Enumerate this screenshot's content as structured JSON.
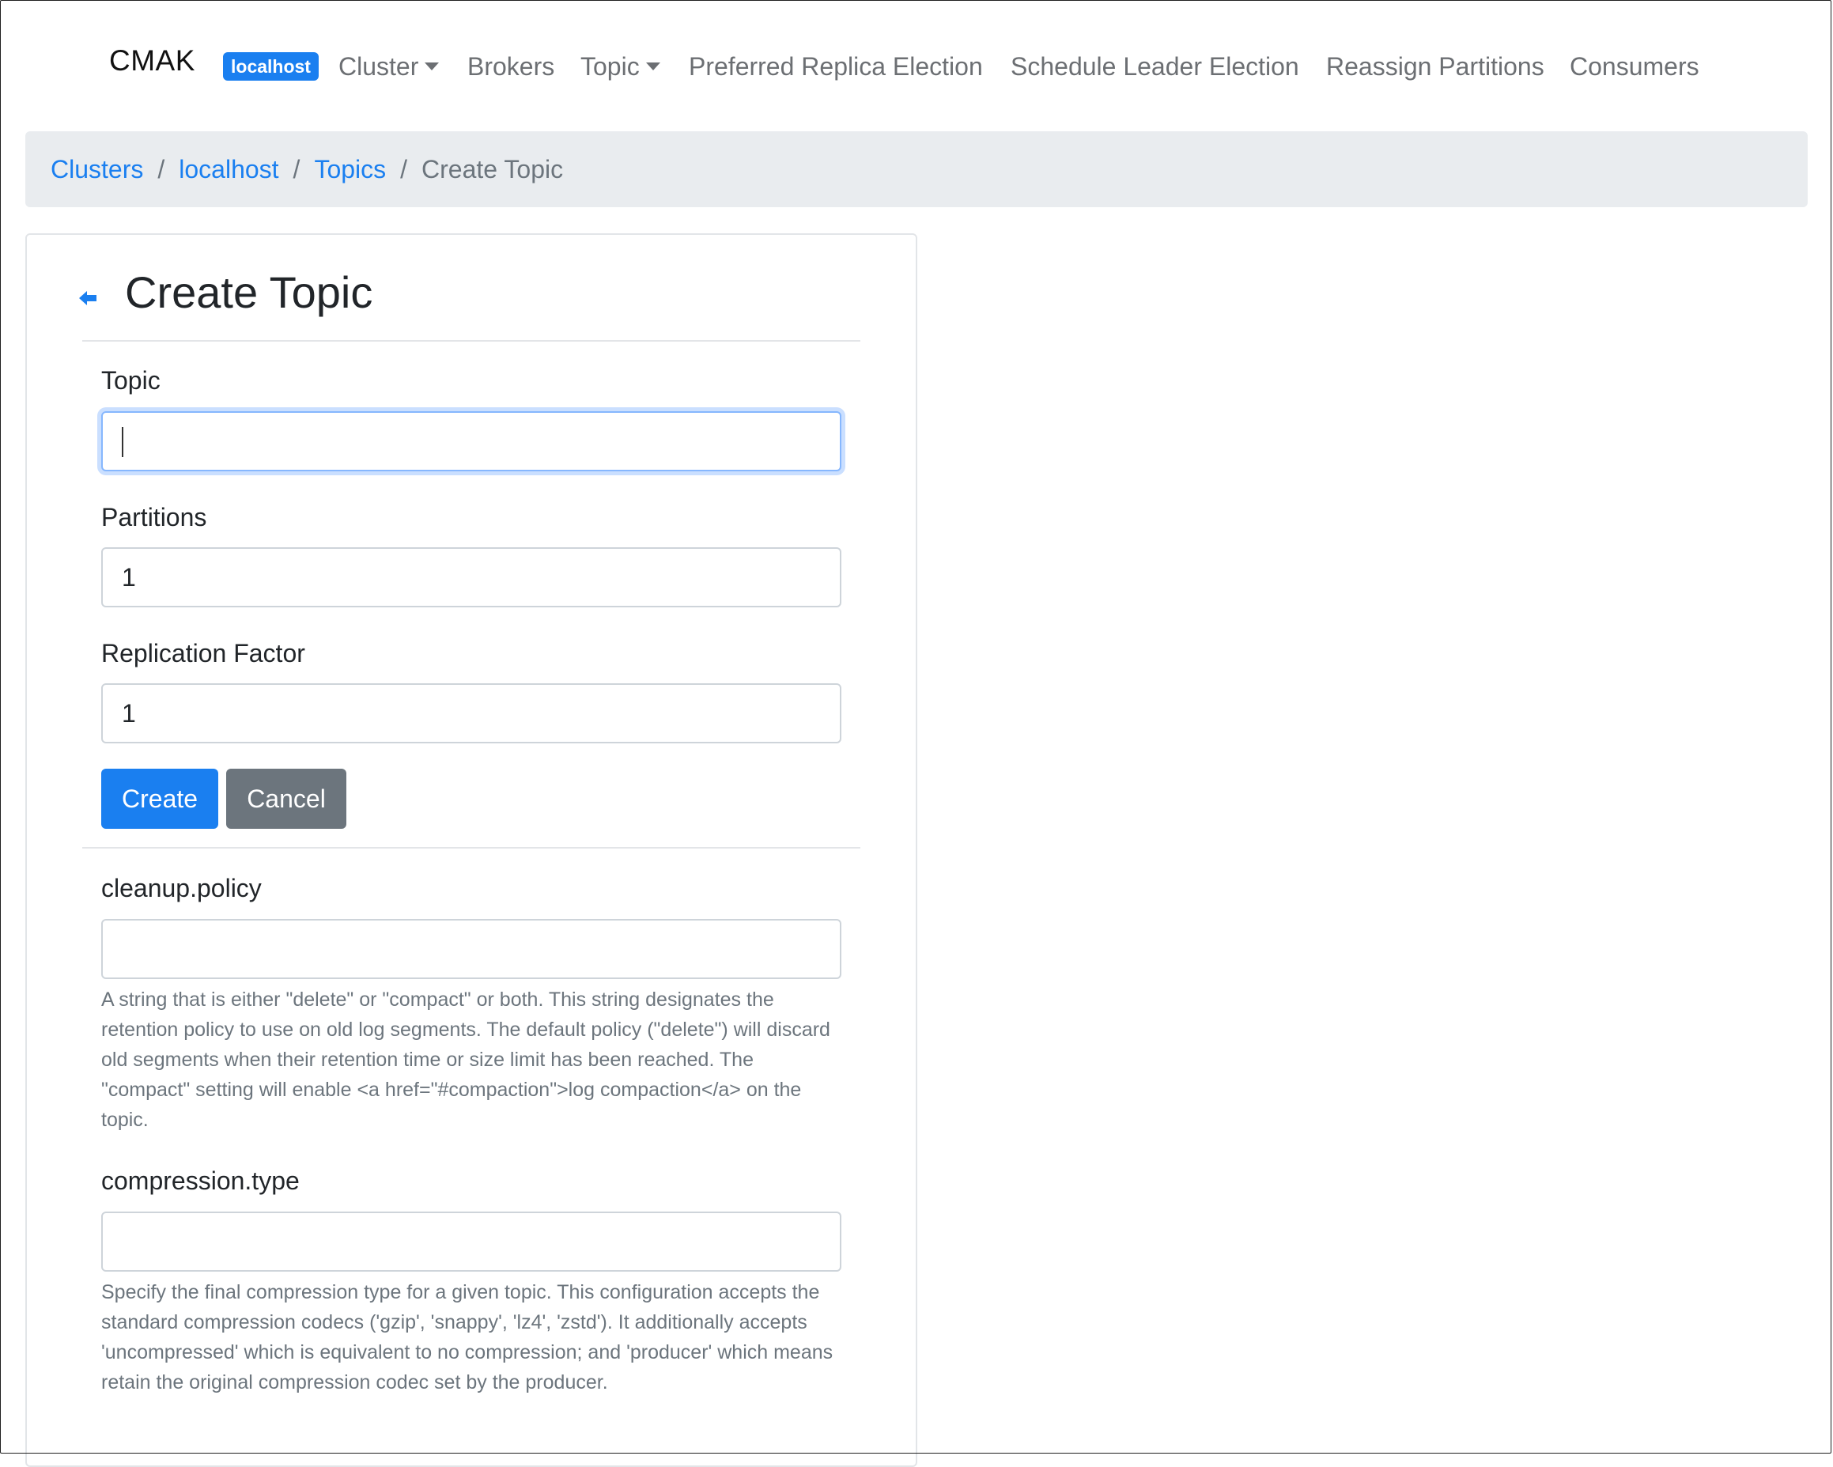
{
  "navbar": {
    "brand": "CMAK",
    "cluster_badge": "localhost",
    "items": [
      {
        "label": "Cluster",
        "dropdown": true
      },
      {
        "label": "Brokers",
        "dropdown": false
      },
      {
        "label": "Topic",
        "dropdown": true
      },
      {
        "label": "Preferred Replica Election",
        "dropdown": false
      },
      {
        "label": "Schedule Leader Election",
        "dropdown": false
      },
      {
        "label": "Reassign Partitions",
        "dropdown": false
      },
      {
        "label": "Consumers",
        "dropdown": false
      }
    ]
  },
  "breadcrumb": {
    "items": [
      "Clusters",
      "localhost",
      "Topics"
    ],
    "active": "Create Topic",
    "separator": "/"
  },
  "form": {
    "title": "Create Topic",
    "topic": {
      "label": "Topic",
      "value": ""
    },
    "partitions": {
      "label": "Partitions",
      "value": "1"
    },
    "replication_factor": {
      "label": "Replication Factor",
      "value": "1"
    },
    "create_label": "Create",
    "cancel_label": "Cancel"
  },
  "configs": [
    {
      "name": "cleanup.policy",
      "value": "",
      "help": "A string that is either \"delete\" or \"compact\" or both. This string designates the retention policy to use on old log segments. The default policy (\"delete\") will discard old segments when their retention time or size limit has been reached. The \"compact\" setting will enable <a href=\"#compaction\">log compaction</a> on the topic."
    },
    {
      "name": "compression.type",
      "value": "",
      "help": "Specify the final compression type for a given topic. This configuration accepts the standard compression codecs ('gzip', 'snappy', 'lz4', 'zstd'). It additionally accepts 'uncompressed' which is equivalent to no compression; and 'producer' which means retain the original compression codec set by the producer."
    }
  ],
  "colors": {
    "primary": "#1a7ff0",
    "secondary": "#6c757d",
    "breadcrumb_bg": "#e9ecef"
  }
}
